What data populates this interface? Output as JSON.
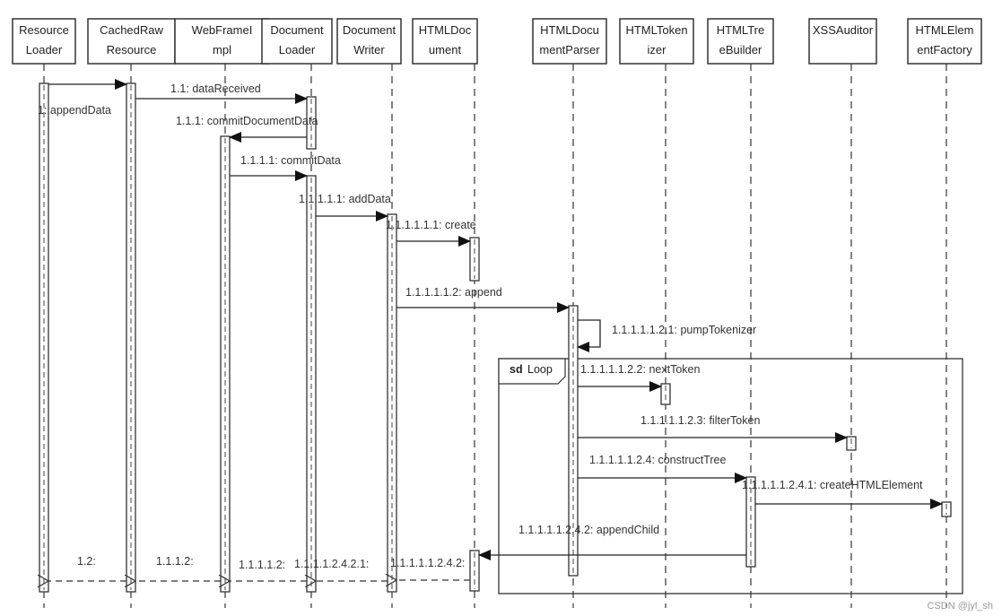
{
  "diagram": {
    "type": "UML sequence diagram",
    "participants": [
      {
        "id": "ResourceLoader",
        "line1": "Resource",
        "line2": "Loader"
      },
      {
        "id": "CachedRawResource",
        "line1": "CachedRaw",
        "line2": "Resource"
      },
      {
        "id": "WebFrameImpl",
        "line1": "WebFrameI",
        "line2": "mpl"
      },
      {
        "id": "DocumentLoader",
        "line1": "Document",
        "line2": "Loader"
      },
      {
        "id": "DocumentWriter",
        "line1": "Document",
        "line2": "Writer"
      },
      {
        "id": "HTMLDocument",
        "line1": "HTMLDoc",
        "line2": "ument"
      },
      {
        "id": "HTMLDocumentParser",
        "line1": "HTMLDocu",
        "line2": "mentParser"
      },
      {
        "id": "HTMLTokenizer",
        "line1": "HTMLToken",
        "line2": "izer"
      },
      {
        "id": "HTMLTreeBuilder",
        "line1": "HTMLTre",
        "line2": "eBuilder"
      },
      {
        "id": "XSSAuditor",
        "line1": "XSSAuditor",
        "line2": ""
      },
      {
        "id": "HTMLElementFactory",
        "line1": "HTMLElem",
        "line2": "entFactory"
      }
    ],
    "messages": [
      {
        "label": "1: appendData",
        "from": "ResourceLoader",
        "to": "CachedRawResource",
        "kind": "call"
      },
      {
        "label": "1.1: dataReceived",
        "from": "CachedRawResource",
        "to": "DocumentLoader",
        "kind": "call"
      },
      {
        "label": "1.1.1: commitDocumentData",
        "from": "DocumentLoader",
        "to": "WebFrameImpl",
        "kind": "call"
      },
      {
        "label": "1.1.1.1: commitData",
        "from": "WebFrameImpl",
        "to": "DocumentLoader",
        "kind": "call"
      },
      {
        "label": "1.1.1.1.1: addData",
        "from": "DocumentLoader",
        "to": "DocumentWriter",
        "kind": "call"
      },
      {
        "label": "1.1.1.1.1.1: create",
        "from": "DocumentWriter",
        "to": "HTMLDocument",
        "kind": "call"
      },
      {
        "label": "1.1.1.1.1.2: append",
        "from": "DocumentWriter",
        "to": "HTMLDocumentParser",
        "kind": "call"
      },
      {
        "label": "1.1.1.1.1.2.1: pumpTokenizer",
        "from": "HTMLDocumentParser",
        "to": "HTMLDocumentParser",
        "kind": "self"
      },
      {
        "label": "1.1.1.1.1.2.2: nextToken",
        "from": "HTMLDocumentParser",
        "to": "HTMLTokenizer",
        "kind": "call"
      },
      {
        "label": "1.1.1.1.1.2.3: filterToken",
        "from": "HTMLDocumentParser",
        "to": "XSSAuditor",
        "kind": "call"
      },
      {
        "label": "1.1.1.1.1.2.4: constructTree",
        "from": "HTMLDocumentParser",
        "to": "HTMLTreeBuilder",
        "kind": "call"
      },
      {
        "label": "1.1.1.1.1.2.4.1: createHTMLElement",
        "from": "HTMLTreeBuilder",
        "to": "HTMLElementFactory",
        "kind": "call"
      },
      {
        "label": "1.1.1.1.1.2.4.2: appendChild",
        "from": "HTMLTreeBuilder",
        "to": "HTMLDocument",
        "kind": "call"
      },
      {
        "label": "1.1.1.1.1.2.4.2:",
        "from": "HTMLDocument",
        "to": "DocumentWriter",
        "kind": "return"
      },
      {
        "label": "1.1.1.1.2.4.2.1:",
        "from": "DocumentWriter",
        "to": "DocumentLoader",
        "kind": "return"
      },
      {
        "label": "1.1.1.1.2:",
        "from": "DocumentLoader",
        "to": "WebFrameImpl",
        "kind": "return"
      },
      {
        "label": "1.1.1.2:",
        "from": "WebFrameImpl",
        "to": "CachedRawResource",
        "kind": "return"
      },
      {
        "label": "1.2:",
        "from": "CachedRawResource",
        "to": "ResourceLoader",
        "kind": "return"
      }
    ],
    "loop_frame": {
      "keyword": "sd",
      "name": "Loop"
    }
  },
  "watermark": "CSDN @jyl_sh"
}
